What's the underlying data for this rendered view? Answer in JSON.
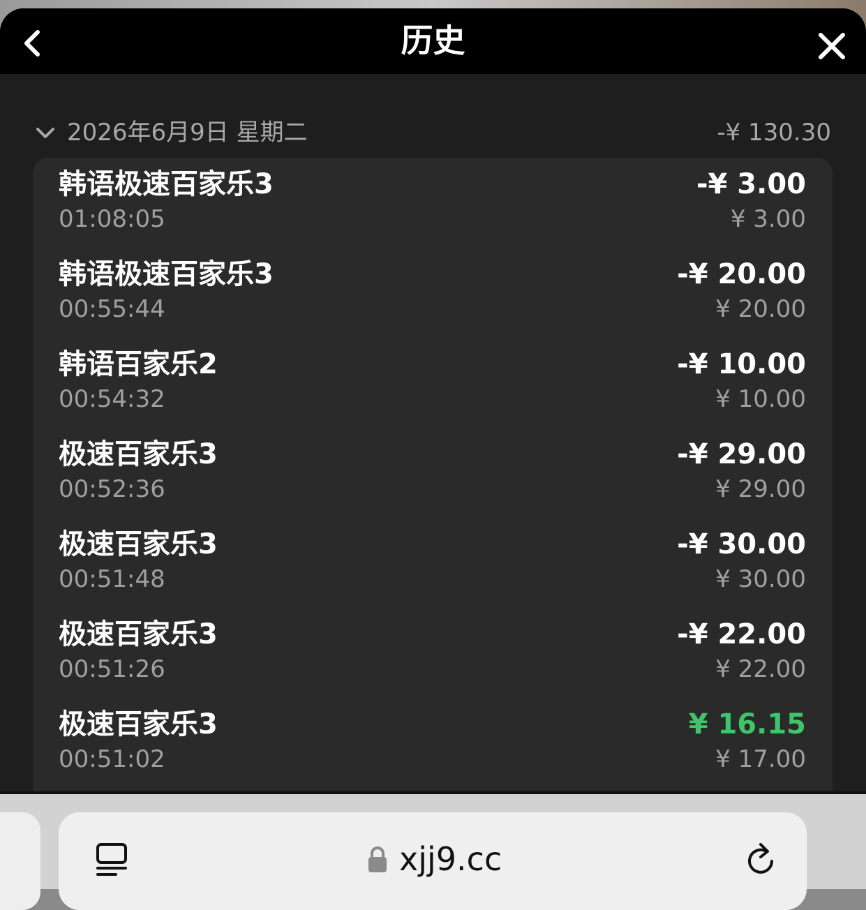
{
  "header": {
    "title": "历史",
    "back_icon": "chevron-left-icon",
    "close_icon": "close-icon"
  },
  "date_group": {
    "label": "2026年6月9日 星期二",
    "total": "-¥ 130.30",
    "expanded": true
  },
  "rows": [
    {
      "name": "韩语极速百家乐3",
      "time": "01:08:05",
      "amount": "-¥ 3.00",
      "bet": "¥ 3.00",
      "positive": false
    },
    {
      "name": "韩语极速百家乐3",
      "time": "00:55:44",
      "amount": "-¥ 20.00",
      "bet": "¥ 20.00",
      "positive": false
    },
    {
      "name": "韩语百家乐2",
      "time": "00:54:32",
      "amount": "-¥ 10.00",
      "bet": "¥ 10.00",
      "positive": false
    },
    {
      "name": "极速百家乐3",
      "time": "00:52:36",
      "amount": "-¥ 29.00",
      "bet": "¥ 29.00",
      "positive": false
    },
    {
      "name": "极速百家乐3",
      "time": "00:51:48",
      "amount": "-¥ 30.00",
      "bet": "¥ 30.00",
      "positive": false
    },
    {
      "name": "极速百家乐3",
      "time": "00:51:26",
      "amount": "-¥ 22.00",
      "bet": "¥ 22.00",
      "positive": false
    },
    {
      "name": "极速百家乐3",
      "time": "00:51:02",
      "amount": "¥ 16.15",
      "bet": "¥ 17.00",
      "positive": true
    }
  ],
  "colors": {
    "positive": "#3fc46a",
    "header_bg": "#000000",
    "sheet_bg": "#1e1e1e",
    "card_bg": "#2a2a2a"
  },
  "browser": {
    "url": "xjj9.cc",
    "reader_icon": "reader-mode-icon",
    "lock_icon": "lock-icon",
    "reload_icon": "reload-icon"
  }
}
